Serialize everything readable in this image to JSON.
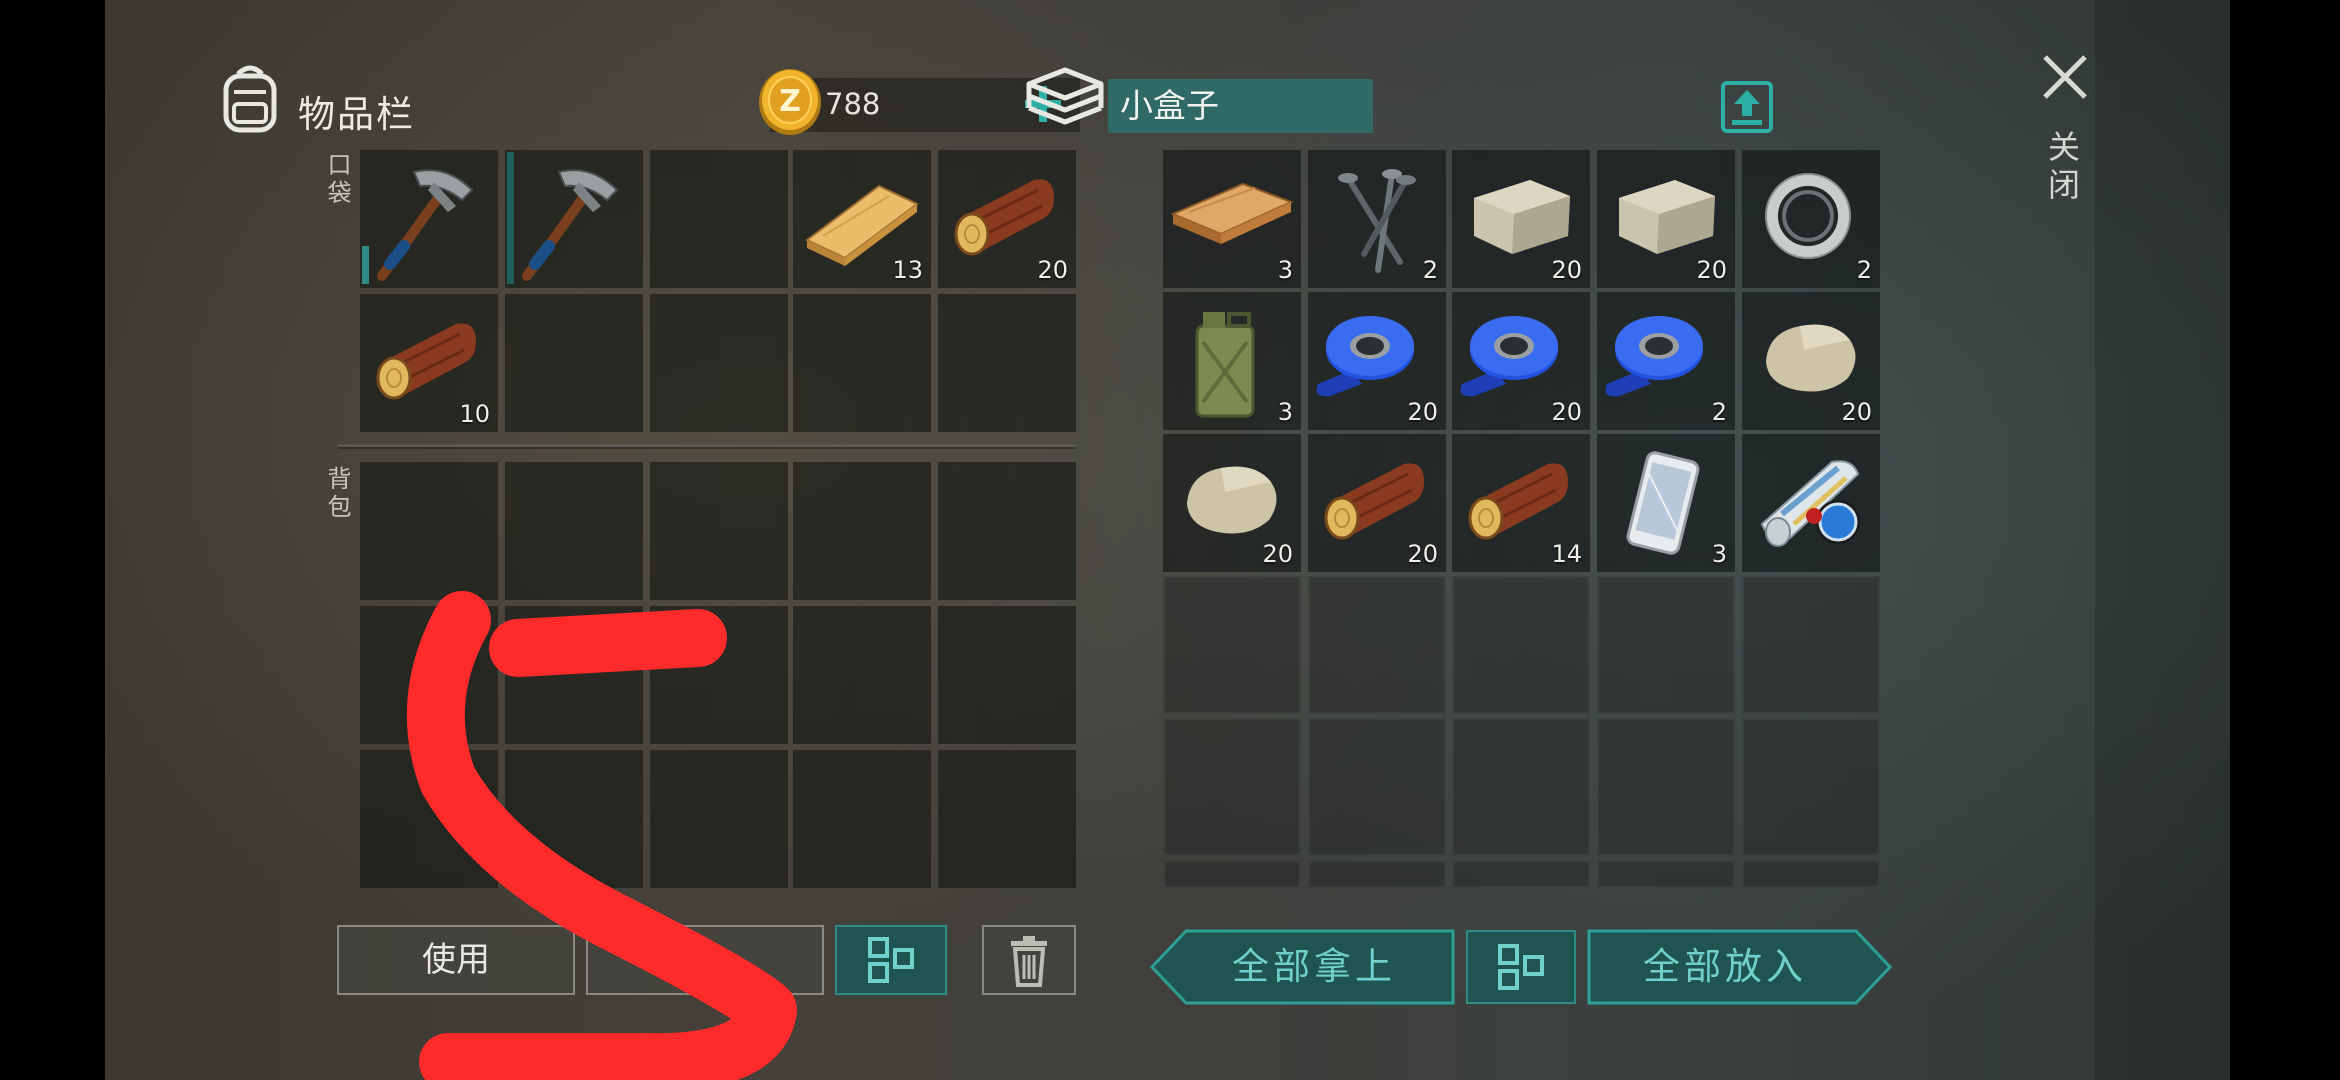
{
  "inventory": {
    "title": "物品栏",
    "coins": "788",
    "pocket_label": "口袋",
    "backpack_label": "背包",
    "pocket_slots": [
      {
        "item": "pickaxe-icon",
        "count": ""
      },
      {
        "item": "pickaxe-icon",
        "count": ""
      },
      {
        "item": "",
        "count": ""
      },
      {
        "item": "wood-plank-icon",
        "count": "13"
      },
      {
        "item": "log-icon",
        "count": "20"
      },
      {
        "item": "log-icon",
        "count": "10"
      },
      {
        "item": "",
        "count": ""
      },
      {
        "item": "",
        "count": ""
      },
      {
        "item": "",
        "count": ""
      },
      {
        "item": "",
        "count": ""
      }
    ]
  },
  "container": {
    "name": "小盒子",
    "slots": [
      {
        "item": "wood-plank-icon",
        "count": "3"
      },
      {
        "item": "nails-icon",
        "count": "2"
      },
      {
        "item": "stone-block-icon",
        "count": "20"
      },
      {
        "item": "stone-block-icon",
        "count": "20"
      },
      {
        "item": "bearing-icon",
        "count": "2"
      },
      {
        "item": "jerrycan-icon",
        "count": "3"
      },
      {
        "item": "tape-icon",
        "count": "20"
      },
      {
        "item": "tape-icon",
        "count": "20"
      },
      {
        "item": "tape-icon",
        "count": "2"
      },
      {
        "item": "stone-icon",
        "count": "20"
      },
      {
        "item": "stone-icon",
        "count": "20"
      },
      {
        "item": "log-icon",
        "count": "20"
      },
      {
        "item": "log-icon",
        "count": "14"
      },
      {
        "item": "smartphone-icon",
        "count": "3"
      },
      {
        "item": "map-scroll-icon",
        "count": ""
      }
    ]
  },
  "buttons": {
    "use": "使用",
    "split": "分",
    "take_all": "全部拿上",
    "put_all": "全部放入",
    "close": "关闭"
  },
  "colors": {
    "accent_teal": "#2d8c85",
    "annotation_red": "#ff2a2a"
  }
}
